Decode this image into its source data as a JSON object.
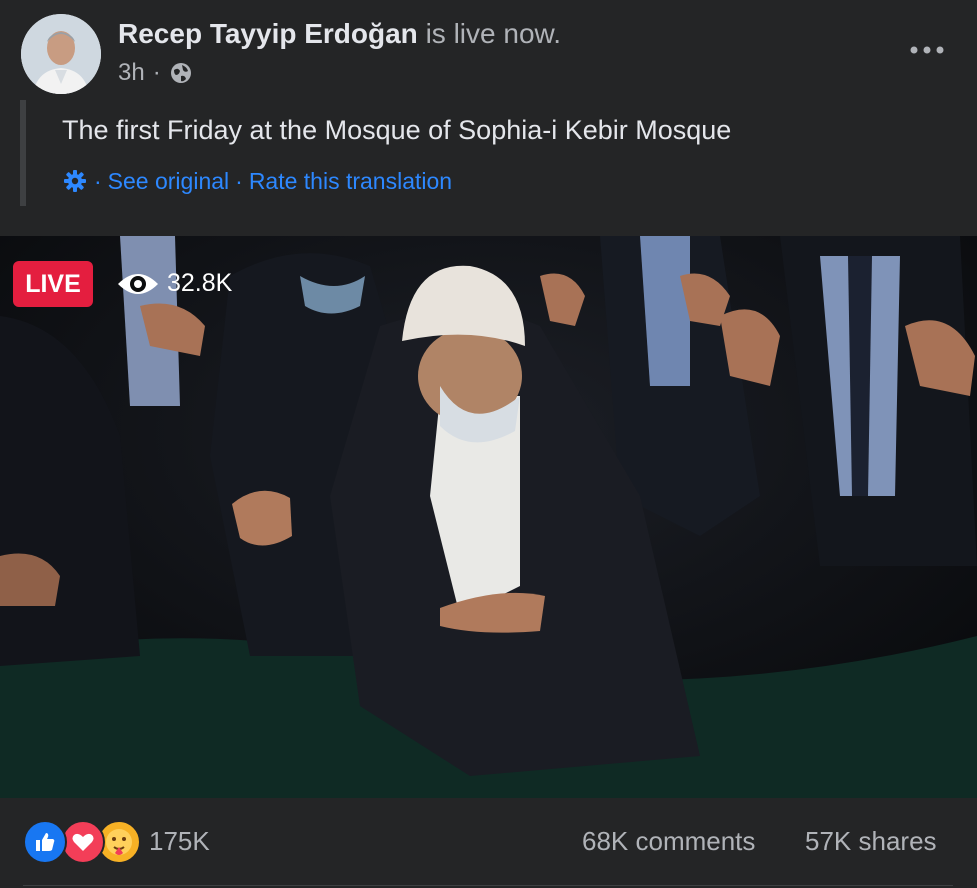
{
  "post": {
    "author_name": "Recep Tayyip Erdoğan",
    "status_suffix": " is live now.",
    "time": "3h",
    "separator": "·",
    "text": "The first Friday at the Mosque of Sophia-i Kebir Mosque",
    "translation": {
      "see_original": "See original",
      "rate": "Rate this translation",
      "sep": "·"
    }
  },
  "video": {
    "live_label": "LIVE",
    "viewers": "32.8K"
  },
  "engagement": {
    "reactions": "175K",
    "comments": "68K comments",
    "shares": "57K shares"
  },
  "icons": [
    "globe-icon",
    "more-icon",
    "gear-icon",
    "eye-icon",
    "like-icon",
    "love-icon",
    "care-icon"
  ],
  "colors": {
    "background": "#242526",
    "link": "#2d88ff",
    "live_badge": "#e41e3f",
    "like": "#1877f2",
    "love": "#f33e58",
    "care": "#f7b125"
  }
}
